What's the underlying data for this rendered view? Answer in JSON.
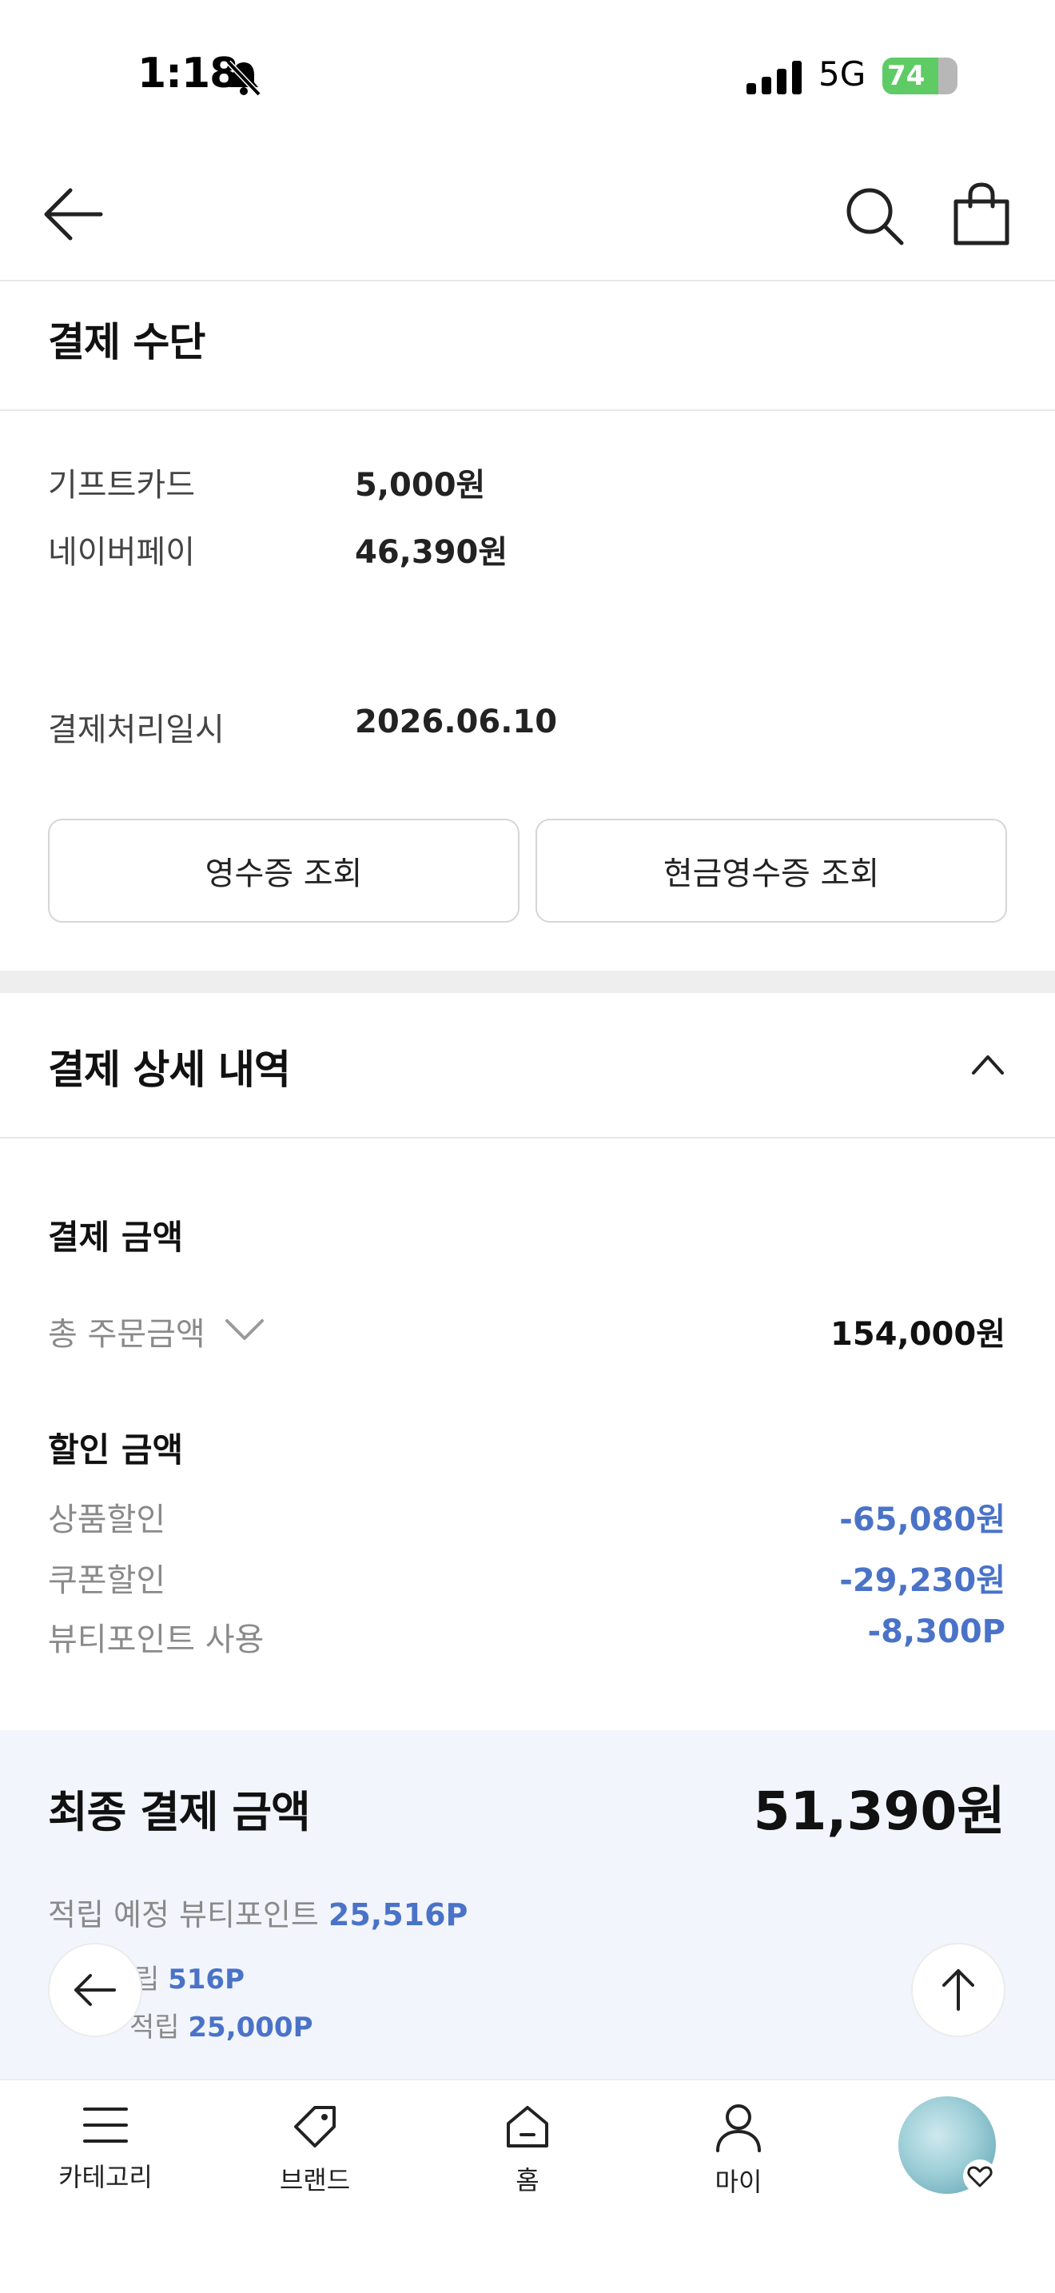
{
  "status_bar": {
    "time": "1:18",
    "network": "5G",
    "battery_percent": "74",
    "battery_level": 0.74
  },
  "header": {
    "back": "back-arrow-icon",
    "search": "search-icon",
    "cart": "shopping-bag-icon"
  },
  "payment_method": {
    "title": "결제 수단",
    "rows": [
      {
        "label": "기프트카드",
        "value": "5,000원"
      },
      {
        "label": "네이버페이",
        "value": "46,390원"
      },
      {
        "label": "결제처리일시",
        "value": "2026.06.10"
      }
    ],
    "buttons": {
      "receipt": "영수증 조회",
      "cash_receipt": "현금영수증 조회"
    }
  },
  "payment_detail": {
    "title": "결제 상세 내역",
    "amount_title": "결제 금액",
    "total_order_label": "총 주문금액",
    "total_order_value": "154,000원",
    "discount_title": "할인 금액",
    "discounts": [
      {
        "label": "상품할인",
        "value": "-65,080원"
      },
      {
        "label": "쿠폰할인",
        "value": "-29,230원"
      },
      {
        "label": "뷰티포인트 사용",
        "value": "-8,300P"
      }
    ],
    "final_label": "최종 결제 금액",
    "final_value": "51,390원",
    "expected_points_label": "적립 예정 뷰티포인트",
    "expected_points_value": "25,516P",
    "point_line_1_label": "립",
    "point_line_1_value": "516P",
    "point_line_2_label": "적립",
    "point_line_2_value": "25,000P"
  },
  "tabbar": {
    "items": [
      {
        "label": "카테고리",
        "icon": "menu-icon"
      },
      {
        "label": "브랜드",
        "icon": "tag-icon"
      },
      {
        "label": "홈",
        "icon": "home-icon"
      },
      {
        "label": "마이",
        "icon": "person-icon"
      }
    ]
  },
  "colors": {
    "accent_blue": "#4a73c8",
    "battery_green": "#5ecb65",
    "panel_bg": "#f2f5fc"
  }
}
